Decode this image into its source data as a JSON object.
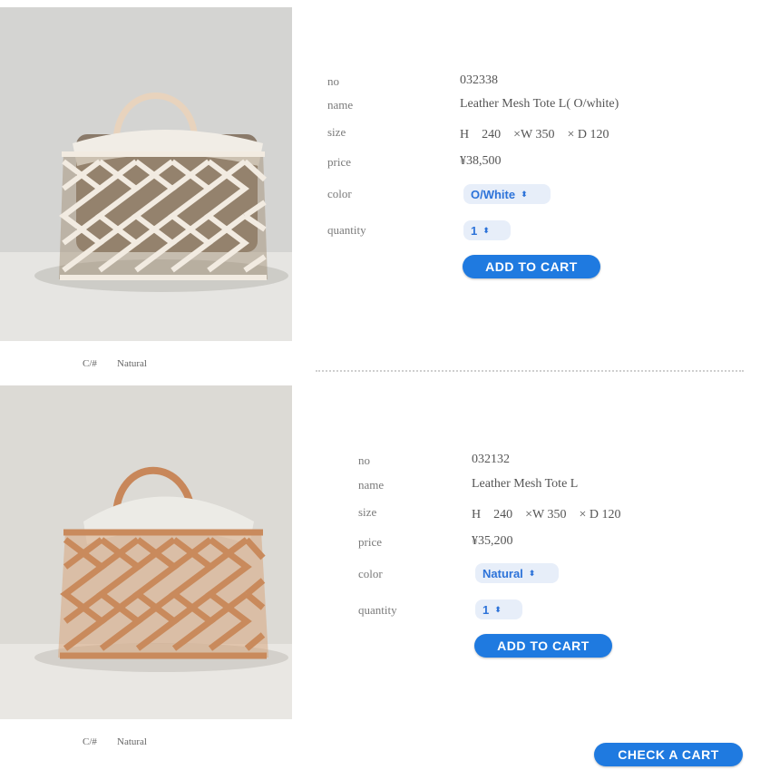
{
  "labels": {
    "no": "no",
    "name": "name",
    "size": "size",
    "price": "price",
    "color": "color",
    "quantity": "quantity"
  },
  "products": [
    {
      "no": "032338",
      "name": "Leather Mesh Tote L( O/white)",
      "size": "H　240　×W 350　× D 120",
      "price": "¥38,500",
      "color_option": "O/White",
      "quantity": "1",
      "add_button": "ADD TO CART",
      "caption_swatch": "C/#",
      "caption_color": "Natural"
    },
    {
      "no": "032132",
      "name": "Leather Mesh Tote L",
      "size": "H　240　×W 350　× D 120",
      "price": "¥35,200",
      "color_option": "Natural",
      "quantity": "1",
      "add_button": "ADD TO CART",
      "caption_swatch": "C/#",
      "caption_color": "Natural"
    }
  ],
  "check_cart_button": "CHECK A CART",
  "colors": {
    "button": "#1f7ae0",
    "select_bg": "#e7eef9",
    "select_text": "#2d73d9",
    "white_bag": "#efe6d8",
    "natural_bag": "#c98a5c"
  },
  "icons": {
    "select_chevron": "up-down-chevron-icon"
  }
}
